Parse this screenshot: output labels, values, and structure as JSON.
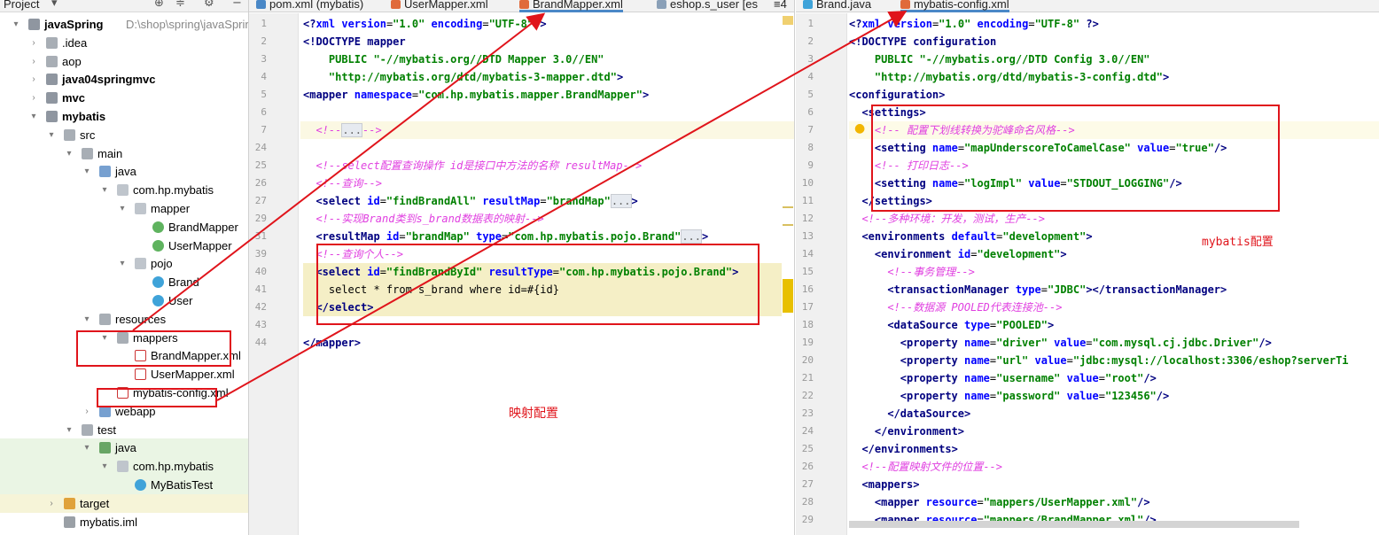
{
  "colors": {
    "annotation_red": "#e0141b",
    "tag": "#000080",
    "attribute": "#0000ff",
    "string": "#008000",
    "comment": "#e040e0",
    "tab_active_underline": "#4a88c7",
    "highlight_yellow": "#f5efc6",
    "gutter": "#f0f0f0"
  },
  "project_panel": {
    "title": "Project",
    "title_icon": "chevron-down-icon",
    "toolbar_icons": [
      "globe-icon",
      "collapse-icon",
      "gear-icon",
      "minimize-icon"
    ],
    "tree": [
      {
        "label": "javaSpring",
        "sub": "D:\\shop\\spring\\javaSpring",
        "depth": 0,
        "arrow": "▾",
        "icon": "module",
        "bold": true
      },
      {
        "label": ".idea",
        "depth": 1,
        "arrow": "›",
        "icon": "folder"
      },
      {
        "label": "aop",
        "depth": 1,
        "arrow": "›",
        "icon": "folder"
      },
      {
        "label": "java04springmvc",
        "depth": 1,
        "arrow": "›",
        "icon": "module",
        "bold": true
      },
      {
        "label": "mvc",
        "depth": 1,
        "arrow": "›",
        "icon": "module",
        "bold": true
      },
      {
        "label": "mybatis",
        "depth": 1,
        "arrow": "▾",
        "icon": "module",
        "bold": true
      },
      {
        "label": "src",
        "depth": 2,
        "arrow": "▾",
        "icon": "folder"
      },
      {
        "label": "main",
        "depth": 3,
        "arrow": "▾",
        "icon": "folder"
      },
      {
        "label": "java",
        "depth": 4,
        "arrow": "▾",
        "icon": "folder-blue"
      },
      {
        "label": "com.hp.mybatis",
        "depth": 5,
        "arrow": "▾",
        "icon": "pkg"
      },
      {
        "label": "mapper",
        "depth": 6,
        "arrow": "▾",
        "icon": "pkg"
      },
      {
        "label": "BrandMapper",
        "depth": 7,
        "arrow": "",
        "icon": "iface"
      },
      {
        "label": "UserMapper",
        "depth": 7,
        "arrow": "",
        "icon": "iface"
      },
      {
        "label": "pojo",
        "depth": 6,
        "arrow": "▾",
        "icon": "pkg"
      },
      {
        "label": "Brand",
        "depth": 7,
        "arrow": "",
        "icon": "cls"
      },
      {
        "label": "User",
        "depth": 7,
        "arrow": "",
        "icon": "cls"
      },
      {
        "label": "resources",
        "depth": 4,
        "arrow": "▾",
        "icon": "folder"
      },
      {
        "label": "mappers",
        "depth": 5,
        "arrow": "▾",
        "icon": "folder"
      },
      {
        "label": "BrandMapper.xml",
        "depth": 6,
        "arrow": "",
        "icon": "xml"
      },
      {
        "label": "UserMapper.xml",
        "depth": 6,
        "arrow": "",
        "icon": "xml"
      },
      {
        "label": "mybatis-config.xml",
        "depth": 5,
        "arrow": "",
        "icon": "xml"
      },
      {
        "label": "webapp",
        "depth": 4,
        "arrow": "›",
        "icon": "folder-blue"
      },
      {
        "label": "test",
        "depth": 3,
        "arrow": "▾",
        "icon": "folder"
      },
      {
        "label": "java",
        "depth": 4,
        "arrow": "▾",
        "icon": "folder-green",
        "bg": "green"
      },
      {
        "label": "com.hp.mybatis",
        "depth": 5,
        "arrow": "▾",
        "icon": "pkg",
        "bg": "green"
      },
      {
        "label": "MyBatisTest",
        "depth": 6,
        "arrow": "",
        "icon": "cls",
        "bg": "green"
      },
      {
        "label": "target",
        "depth": 2,
        "arrow": "›",
        "icon": "folder-orange",
        "bg": "yellow"
      },
      {
        "label": "mybatis.iml",
        "depth": 2,
        "arrow": "",
        "icon": "iml"
      }
    ]
  },
  "editor_left": {
    "tabs": [
      {
        "label": "pom.xml (mybatis)",
        "icon": "m",
        "active": false
      },
      {
        "label": "UserMapper.xml",
        "icon": "xml",
        "active": false
      },
      {
        "label": "BrandMapper.xml",
        "icon": "xml",
        "active": true
      },
      {
        "label": "eshop.s_user [es",
        "icon": "table",
        "active": false
      },
      {
        "label": "≡4",
        "icon": "",
        "active": false
      }
    ],
    "lines": [
      {
        "n": "1",
        "segs": [
          [
            "t",
            "<?"
          ],
          [
            "a",
            "xml version"
          ],
          [
            "",
            "="
          ],
          [
            "s",
            "\"1.0\" "
          ],
          [
            "a",
            "encoding"
          ],
          [
            "",
            "="
          ],
          [
            "s",
            "\"UTF-8\""
          ],
          [
            "t",
            "?>"
          ]
        ],
        "indent": 0
      },
      {
        "n": "2",
        "segs": [
          [
            "t",
            "<!DOCTYPE mapper"
          ]
        ],
        "indent": 0
      },
      {
        "n": "3",
        "segs": [
          [
            "s",
            "PUBLIC \"-//mybatis.org//DTD Mapper 3.0//EN\""
          ]
        ],
        "indent": 4
      },
      {
        "n": "4",
        "segs": [
          [
            "s",
            "\"http://mybatis.org/dtd/mybatis-3-mapper.dtd\""
          ],
          [
            "t",
            ">"
          ]
        ],
        "indent": 4
      },
      {
        "n": "5",
        "segs": [
          [
            "t",
            "<mapper "
          ],
          [
            "a",
            "namespace"
          ],
          [
            "",
            "="
          ],
          [
            "s",
            "\"com.hp.mybatis.mapper.BrandMapper\""
          ],
          [
            "t",
            ">"
          ]
        ],
        "indent": 0
      },
      {
        "n": "6",
        "segs": [],
        "indent": 0
      },
      {
        "n": "7",
        "segs": [
          [
            "c",
            "<!--"
          ],
          [
            "f",
            "..."
          ],
          [
            "c",
            "-->"
          ]
        ],
        "indent": 2
      },
      {
        "n": "24",
        "segs": [],
        "indent": 0
      },
      {
        "n": "25",
        "segs": [
          [
            "c",
            "<!--select配置查询操作 id是接口中方法的名称 resultMap-->"
          ]
        ],
        "indent": 2
      },
      {
        "n": "26",
        "segs": [
          [
            "c",
            "<!--查询-->"
          ]
        ],
        "indent": 2
      },
      {
        "n": "27",
        "segs": [
          [
            "t",
            "<select "
          ],
          [
            "a",
            "id"
          ],
          [
            "",
            "="
          ],
          [
            "s",
            "\"findBrandAll\" "
          ],
          [
            "a",
            "resultMap"
          ],
          [
            "",
            "="
          ],
          [
            "s",
            "\"brandMap\""
          ],
          [
            "f",
            "..."
          ],
          [
            "t",
            ">"
          ]
        ],
        "indent": 2
      },
      {
        "n": "29",
        "segs": [
          [
            "c",
            "<!--实现Brand类到s_brand数据表的映射-->"
          ]
        ],
        "indent": 2
      },
      {
        "n": "31",
        "segs": [
          [
            "t",
            "<resultMap "
          ],
          [
            "a",
            "id"
          ],
          [
            "",
            "="
          ],
          [
            "s",
            "\"brandMap\" "
          ],
          [
            "a",
            "type"
          ],
          [
            "",
            "="
          ],
          [
            "s",
            "\"com.hp.mybatis.pojo.Brand\""
          ],
          [
            "f",
            "..."
          ],
          [
            "t",
            ">"
          ]
        ],
        "indent": 2
      },
      {
        "n": "39",
        "segs": [
          [
            "c",
            "<!--查询个人-->"
          ]
        ],
        "indent": 2
      },
      {
        "n": "40",
        "segs": [
          [
            "t",
            "<select "
          ],
          [
            "a",
            "id"
          ],
          [
            "",
            "="
          ],
          [
            "s",
            "\"findBrandById\" "
          ],
          [
            "a",
            "resultType"
          ],
          [
            "",
            "="
          ],
          [
            "s",
            "\"com.hp.mybatis.pojo.Brand\""
          ],
          [
            "t",
            ">"
          ]
        ],
        "indent": 2,
        "hl": true
      },
      {
        "n": "41",
        "segs": [
          [
            "",
            "select * from s_brand where id=#{id}"
          ]
        ],
        "indent": 4,
        "hl": true
      },
      {
        "n": "42",
        "segs": [
          [
            "t",
            "</select>"
          ]
        ],
        "indent": 2,
        "hl": true
      },
      {
        "n": "43",
        "segs": [],
        "indent": 0
      },
      {
        "n": "44",
        "segs": [
          [
            "t",
            "</mapper>"
          ]
        ],
        "indent": 0
      }
    ]
  },
  "editor_right": {
    "tabs": [
      {
        "label": "Brand.java",
        "icon": "class",
        "active": false
      },
      {
        "label": "mybatis-config.xml",
        "icon": "xml",
        "active": true
      }
    ],
    "lines": [
      {
        "n": "1",
        "segs": [
          [
            "t",
            "<?"
          ],
          [
            "a",
            "xml version"
          ],
          [
            "",
            "="
          ],
          [
            "s",
            "\"1.0\" "
          ],
          [
            "a",
            "encoding"
          ],
          [
            "",
            "="
          ],
          [
            "s",
            "\"UTF-8\" "
          ],
          [
            "t",
            "?>"
          ]
        ],
        "indent": 0
      },
      {
        "n": "2",
        "segs": [
          [
            "t",
            "<!DOCTYPE configuration"
          ]
        ],
        "indent": 0
      },
      {
        "n": "3",
        "segs": [
          [
            "s",
            "PUBLIC \"-//mybatis.org//DTD Config 3.0//EN\""
          ]
        ],
        "indent": 4
      },
      {
        "n": "4",
        "segs": [
          [
            "s",
            "\"http://mybatis.org/dtd/mybatis-3-config.dtd\""
          ],
          [
            "t",
            ">"
          ]
        ],
        "indent": 4
      },
      {
        "n": "5",
        "segs": [
          [
            "t",
            "<configuration>"
          ]
        ],
        "indent": 0
      },
      {
        "n": "6",
        "segs": [
          [
            "t",
            "<settings>"
          ]
        ],
        "indent": 2
      },
      {
        "n": "7",
        "segs": [
          [
            "c",
            "<!-- 配置下划线转换为驼峰命名风格-->"
          ]
        ],
        "indent": 4
      },
      {
        "n": "8",
        "segs": [
          [
            "t",
            "<setting "
          ],
          [
            "a",
            "name"
          ],
          [
            "",
            "="
          ],
          [
            "s",
            "\"mapUnderscoreToCamelCase\" "
          ],
          [
            "a",
            "value"
          ],
          [
            "",
            "="
          ],
          [
            "s",
            "\"true\""
          ],
          [
            "t",
            "/>"
          ]
        ],
        "indent": 4
      },
      {
        "n": "9",
        "segs": [
          [
            "c",
            "<!-- 打印日志-->"
          ]
        ],
        "indent": 4
      },
      {
        "n": "10",
        "segs": [
          [
            "t",
            "<setting "
          ],
          [
            "a",
            "name"
          ],
          [
            "",
            "="
          ],
          [
            "s",
            "\"logImpl\" "
          ],
          [
            "a",
            "value"
          ],
          [
            "",
            "="
          ],
          [
            "s",
            "\"STDOUT_LOGGING\""
          ],
          [
            "t",
            "/>"
          ]
        ],
        "indent": 4
      },
      {
        "n": "11",
        "segs": [
          [
            "t",
            "</settings>"
          ]
        ],
        "indent": 2
      },
      {
        "n": "12",
        "segs": [
          [
            "c",
            "<!--多种环境：开发，测试，生产-->"
          ]
        ],
        "indent": 2
      },
      {
        "n": "13",
        "segs": [
          [
            "t",
            "<environments "
          ],
          [
            "a",
            "default"
          ],
          [
            "",
            "="
          ],
          [
            "s",
            "\"development\""
          ],
          [
            "t",
            ">"
          ]
        ],
        "indent": 2
      },
      {
        "n": "14",
        "segs": [
          [
            "t",
            "<environment "
          ],
          [
            "a",
            "id"
          ],
          [
            "",
            "="
          ],
          [
            "s",
            "\"development\""
          ],
          [
            "t",
            ">"
          ]
        ],
        "indent": 4
      },
      {
        "n": "15",
        "segs": [
          [
            "c",
            "<!--事务管理-->"
          ]
        ],
        "indent": 6
      },
      {
        "n": "16",
        "segs": [
          [
            "t",
            "<transactionManager "
          ],
          [
            "a",
            "type"
          ],
          [
            "",
            "="
          ],
          [
            "s",
            "\"JDBC\""
          ],
          [
            "t",
            "></transactionManager>"
          ]
        ],
        "indent": 6
      },
      {
        "n": "17",
        "segs": [
          [
            "c",
            "<!--数据源 POOLED代表连接池-->"
          ]
        ],
        "indent": 6
      },
      {
        "n": "18",
        "segs": [
          [
            "t",
            "<dataSource "
          ],
          [
            "a",
            "type"
          ],
          [
            "",
            "="
          ],
          [
            "s",
            "\"POOLED\""
          ],
          [
            "t",
            ">"
          ]
        ],
        "indent": 6
      },
      {
        "n": "19",
        "segs": [
          [
            "t",
            "<property "
          ],
          [
            "a",
            "name"
          ],
          [
            "",
            "="
          ],
          [
            "s",
            "\"driver\" "
          ],
          [
            "a",
            "value"
          ],
          [
            "",
            "="
          ],
          [
            "s",
            "\"com.mysql.cj.jdbc.Driver\""
          ],
          [
            "t",
            "/>"
          ]
        ],
        "indent": 8
      },
      {
        "n": "20",
        "segs": [
          [
            "t",
            "<property "
          ],
          [
            "a",
            "name"
          ],
          [
            "",
            "="
          ],
          [
            "s",
            "\"url\" "
          ],
          [
            "a",
            "value"
          ],
          [
            "",
            "="
          ],
          [
            "s",
            "\"jdbc:mysql://localhost:3306/eshop?serverTi"
          ]
        ],
        "indent": 8
      },
      {
        "n": "21",
        "segs": [
          [
            "t",
            "<property "
          ],
          [
            "a",
            "name"
          ],
          [
            "",
            "="
          ],
          [
            "s",
            "\"username\" "
          ],
          [
            "a",
            "value"
          ],
          [
            "",
            "="
          ],
          [
            "s",
            "\"root\""
          ],
          [
            "t",
            "/>"
          ]
        ],
        "indent": 8
      },
      {
        "n": "22",
        "segs": [
          [
            "t",
            "<property "
          ],
          [
            "a",
            "name"
          ],
          [
            "",
            "="
          ],
          [
            "s",
            "\"password\" "
          ],
          [
            "a",
            "value"
          ],
          [
            "",
            "="
          ],
          [
            "s",
            "\"123456\""
          ],
          [
            "t",
            "/>"
          ]
        ],
        "indent": 8
      },
      {
        "n": "23",
        "segs": [
          [
            "t",
            "</dataSource>"
          ]
        ],
        "indent": 6
      },
      {
        "n": "24",
        "segs": [
          [
            "t",
            "</environment>"
          ]
        ],
        "indent": 4
      },
      {
        "n": "25",
        "segs": [
          [
            "t",
            "</environments>"
          ]
        ],
        "indent": 2
      },
      {
        "n": "26",
        "segs": [
          [
            "c",
            "<!--配置映射文件的位置-->"
          ]
        ],
        "indent": 2
      },
      {
        "n": "27",
        "segs": [
          [
            "t",
            "<mappers>"
          ]
        ],
        "indent": 2
      },
      {
        "n": "28",
        "segs": [
          [
            "t",
            "<mapper "
          ],
          [
            "a",
            "resource"
          ],
          [
            "",
            "="
          ],
          [
            "s",
            "\"mappers/UserMapper.xml\""
          ],
          [
            "t",
            "/>"
          ]
        ],
        "indent": 4
      },
      {
        "n": "29",
        "segs": [
          [
            "t",
            "<mapper "
          ],
          [
            "a",
            "resource"
          ],
          [
            "",
            "="
          ],
          [
            "s",
            "\"mappers/BrandMapper.xml\""
          ],
          [
            "t",
            "/>"
          ]
        ],
        "indent": 4
      }
    ]
  },
  "annotations": {
    "mapping_config": "映射配置",
    "mybatis_config": "mybatis配置"
  },
  "bulb_icon": "lightbulb-icon"
}
